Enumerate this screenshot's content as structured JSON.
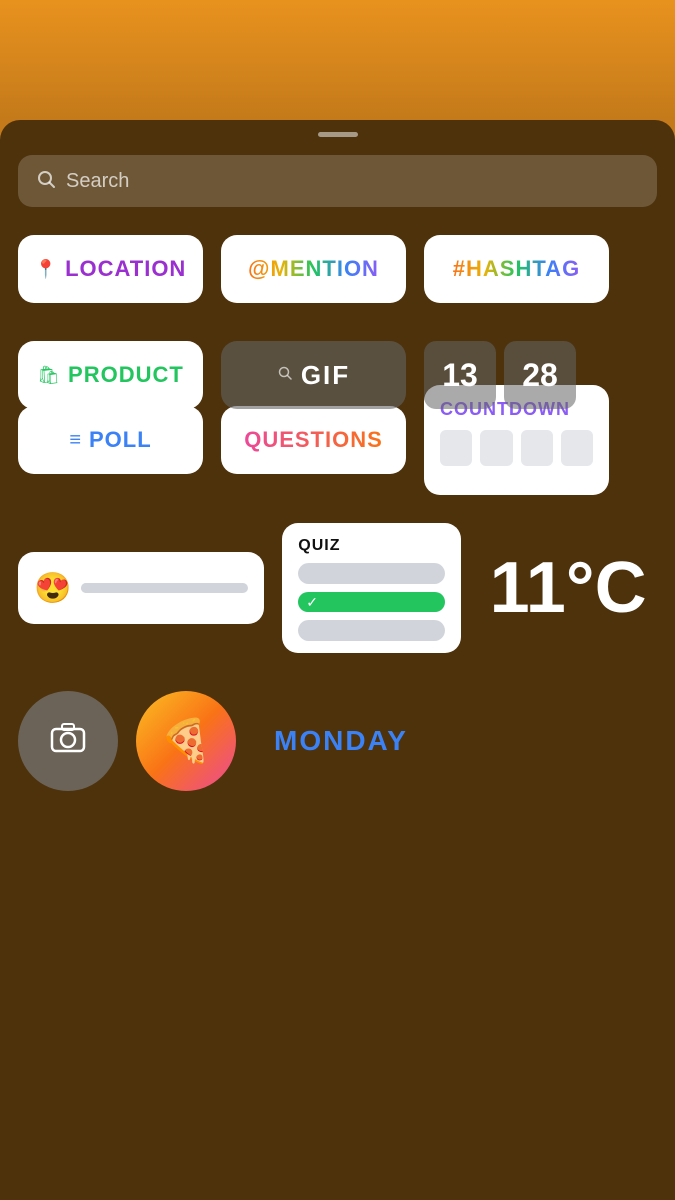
{
  "topBar": {
    "height": 120
  },
  "searchBar": {
    "placeholder": "Search",
    "icon": "search"
  },
  "stickers": {
    "row1": [
      {
        "id": "location",
        "label": "LOCATION",
        "icon": "📍",
        "color": "#9b30d0"
      },
      {
        "id": "mention",
        "label": "@MENTION"
      },
      {
        "id": "hashtag",
        "label": "#HASHTAG"
      }
    ],
    "row2": [
      {
        "id": "product",
        "label": "PRODUCT",
        "icon": "🛍",
        "color": "#22c55e"
      },
      {
        "id": "gif",
        "label": "GIF",
        "icon": "🔍"
      },
      {
        "id": "time",
        "values": [
          "13",
          "28"
        ]
      }
    ],
    "row3": [
      {
        "id": "poll",
        "label": "POLL",
        "icon": "≡",
        "color": "#3b82f6"
      },
      {
        "id": "questions",
        "label": "QUESTIONS"
      },
      {
        "id": "countdown",
        "label": "COUNTDOWN"
      }
    ],
    "row4": [
      {
        "id": "emoji-slider",
        "emoji": "😍"
      },
      {
        "id": "quiz",
        "title": "QUIZ"
      },
      {
        "id": "temperature",
        "value": "11°C"
      }
    ],
    "row5": [
      {
        "id": "camera",
        "icon": "📷"
      },
      {
        "id": "food",
        "emoji": "🍕"
      },
      {
        "id": "monday",
        "label": "MONDAY"
      }
    ]
  }
}
